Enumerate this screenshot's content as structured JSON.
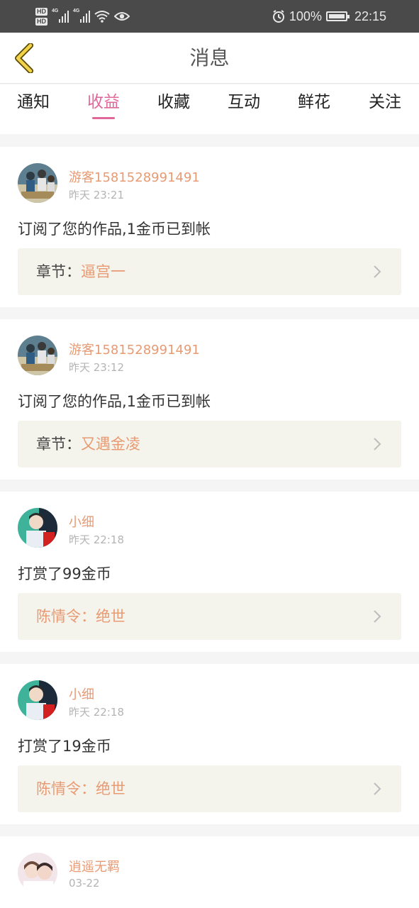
{
  "status_bar": {
    "hd1": "HD",
    "hd2": "HD",
    "net1": "4G",
    "net2": "4G",
    "battery": "100%",
    "time": "22:15",
    "icons": [
      "signal-icon",
      "wifi-icon",
      "eye-icon",
      "alarm-icon",
      "battery-icon"
    ]
  },
  "header": {
    "title": "消息",
    "back_icon": "chevron-left-icon"
  },
  "tabs": [
    {
      "label": "通知",
      "active": false
    },
    {
      "label": "收益",
      "active": true
    },
    {
      "label": "收藏",
      "active": false
    },
    {
      "label": "互动",
      "active": false
    },
    {
      "label": "鲜花",
      "active": false
    },
    {
      "label": "关注",
      "active": false
    }
  ],
  "messages": [
    {
      "user": "游客1581528991491",
      "time": "昨天 23:21",
      "text": "订阅了您的作品,1金币已到帐",
      "ref_label": "章节：",
      "ref_value": "逼宫一"
    },
    {
      "user": "游客1581528991491",
      "time": "昨天 23:12",
      "text": "订阅了您的作品,1金币已到帐",
      "ref_label": "章节：",
      "ref_value": "又遇金凌"
    },
    {
      "user": "小细",
      "time": "昨天 22:18",
      "text": "打赏了99金币",
      "ref_label": "陈情令：",
      "ref_value": "绝世"
    },
    {
      "user": "小细",
      "time": "昨天 22:18",
      "text": "打赏了19金币",
      "ref_label": "陈情令：",
      "ref_value": "绝世"
    },
    {
      "user": "逍遥无羁",
      "time": "03-22"
    }
  ],
  "colors": {
    "accent_pink": "#e0679a",
    "username_orange": "#e89a73",
    "back_arrow_yellow": "#f0d24b"
  }
}
